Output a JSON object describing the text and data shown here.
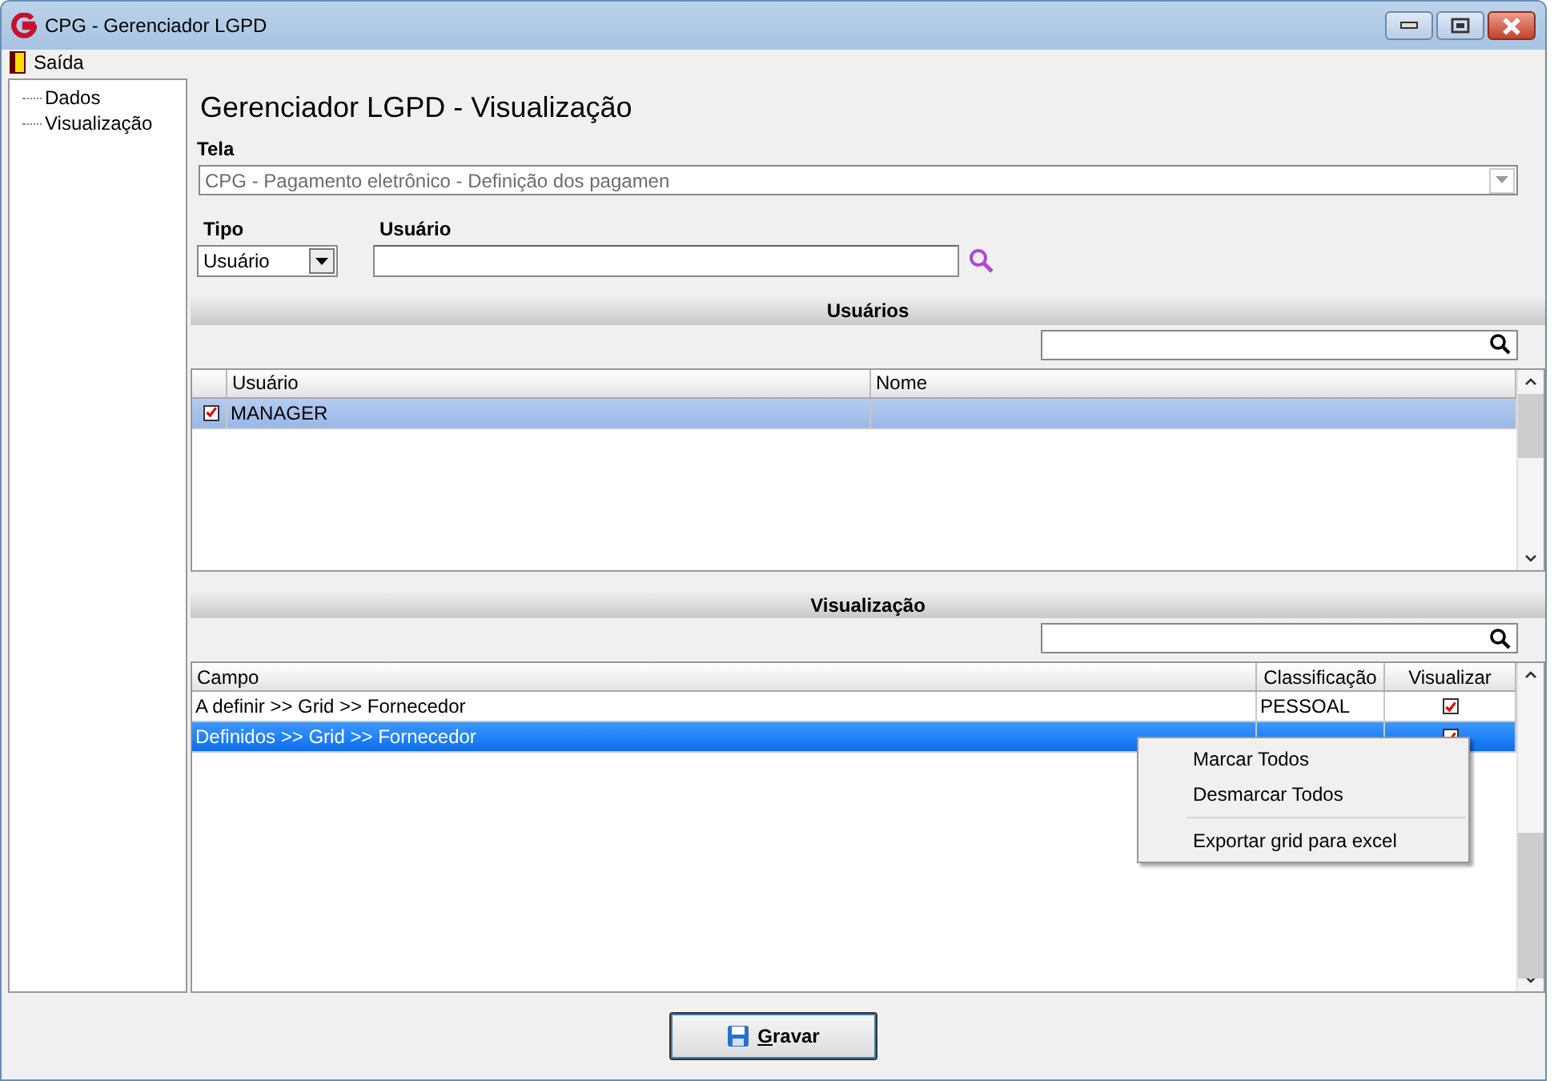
{
  "window": {
    "title": "CPG - Gerenciador LGPD"
  },
  "menu": [
    {
      "label": "Saída"
    }
  ],
  "tree": {
    "items": [
      {
        "label": "Dados"
      },
      {
        "label": "Visualização"
      }
    ]
  },
  "heading": "Gerenciador LGPD - Visualização",
  "tela": {
    "label": "Tela",
    "value": "CPG - Pagamento eletrônico - Definição dos pagamen",
    "disabled": true
  },
  "tipo": {
    "label": "Tipo",
    "value": "Usuário"
  },
  "usuario": {
    "label": "Usuário"
  },
  "users": {
    "title": "Usuários",
    "focused": false,
    "columns": [
      "Usuário",
      "Nome"
    ],
    "rows": [
      {
        "checked": true,
        "selected": true,
        "usuario": "MANAGER"
      }
    ]
  },
  "visualizacao": {
    "title": "Visualização",
    "focused": true,
    "columns": [
      "Campo",
      "Classificação",
      "Visualizar"
    ],
    "rows": [
      {
        "campo": "A definir >> Grid >> Fornecedor",
        "classificacao": "PESSOAL",
        "visualizar": true,
        "selected": false
      },
      {
        "campo": "Definidos >> Grid >> Fornecedor",
        "visualizar": true,
        "selected": true
      }
    ]
  },
  "context_menu": {
    "items": [
      {
        "kind": "item",
        "label": "Marcar Todos"
      },
      {
        "kind": "item",
        "label": "Desmarcar Todos"
      },
      {
        "kind": "separator"
      },
      {
        "kind": "item",
        "label": "Exportar grid para excel"
      }
    ]
  },
  "save_button": {
    "label": "Gravar"
  }
}
